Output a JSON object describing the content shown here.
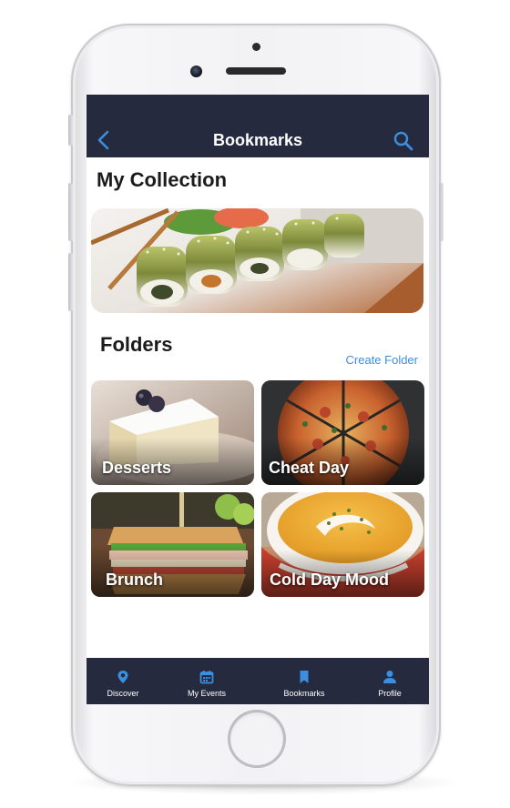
{
  "navbar": {
    "title": "Bookmarks"
  },
  "collection": {
    "heading": "My Collection"
  },
  "folders": {
    "heading": "Folders",
    "create_label": "Create Folder",
    "items": [
      {
        "label": "Desserts"
      },
      {
        "label": "Cheat Day"
      },
      {
        "label": "Brunch"
      },
      {
        "label": "Cold Day Mood"
      }
    ]
  },
  "tabs": [
    {
      "label": "Discover",
      "icon": "location-pin-icon"
    },
    {
      "label": "My Events",
      "icon": "calendar-icon"
    },
    {
      "label": "Bookmarks",
      "icon": "bookmark-icon"
    },
    {
      "label": "Profile",
      "icon": "person-icon"
    }
  ],
  "colors": {
    "bar_background": "#252a3e",
    "accent": "#3b8fe0",
    "text": "#1b1b1b"
  }
}
